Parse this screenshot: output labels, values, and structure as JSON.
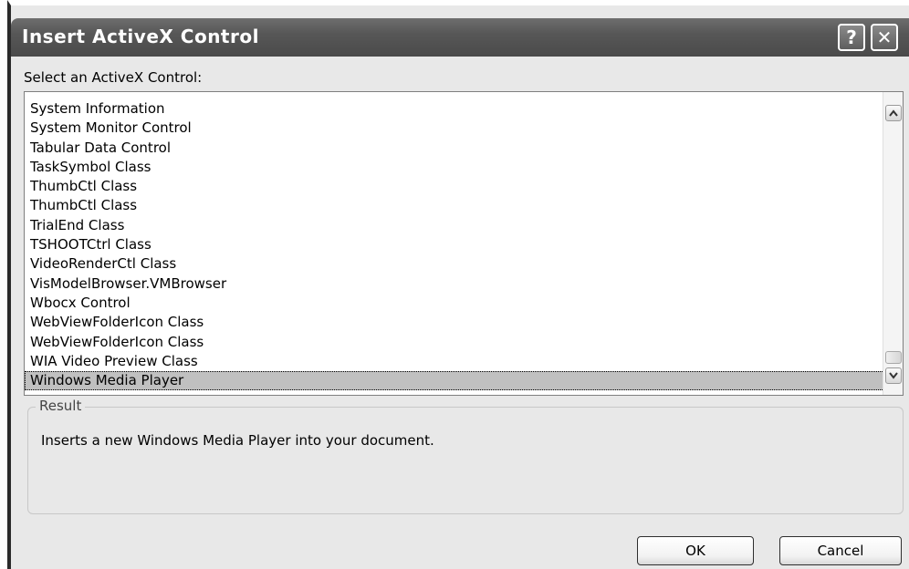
{
  "window": {
    "title": "Insert ActiveX Control",
    "help_label": "?",
    "close_label": "✕"
  },
  "prompt": "Select an ActiveX Control:",
  "controls": [
    "System Information",
    "System Monitor Control",
    "Tabular Data Control",
    "TaskSymbol Class",
    "ThumbCtl Class",
    "ThumbCtl Class",
    "TrialEnd Class",
    "TSHOOTCtrl Class",
    "VideoRenderCtl Class",
    "VisModelBrowser.VMBrowser",
    "Wbocx Control",
    "WebViewFolderIcon Class",
    "WebViewFolderIcon Class",
    "WIA Video Preview Class",
    "Windows Media Player"
  ],
  "selected_control": "Windows Media Player",
  "result": {
    "legend": "Result",
    "text": "Inserts a new Windows Media Player into your document."
  },
  "buttons": {
    "ok": "OK",
    "cancel": "Cancel"
  },
  "icons": {
    "help": "help-icon",
    "close": "close-icon",
    "scroll_up": "chevron-up-icon",
    "scroll_down": "chevron-down-icon"
  }
}
